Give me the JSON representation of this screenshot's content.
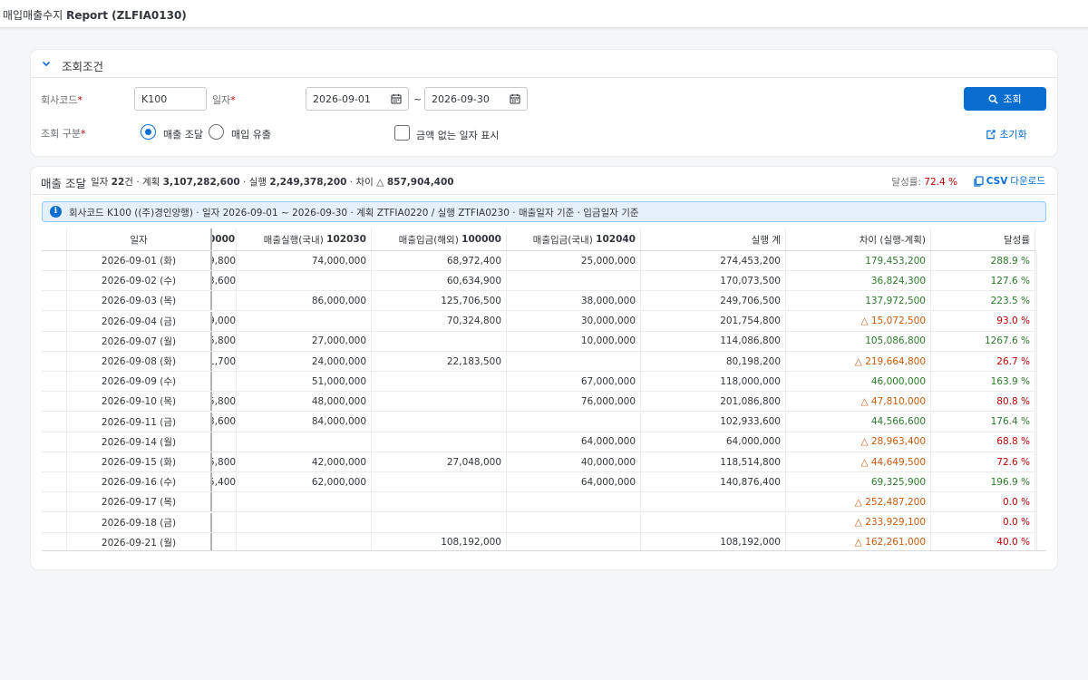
{
  "app": {
    "title_prefix": "매입매출수지",
    "title_bold": "Report (ZLFIA0130)"
  },
  "filter": {
    "header": "조회조건",
    "company_label": "회사코드",
    "company_value": "K100",
    "date_label": "일자",
    "date_from": "2026-09-01",
    "date_sep": "~",
    "date_to": "2026-09-30",
    "type_label": "조회 구분",
    "radio_sales": "매출 조달",
    "radio_purchase": "매입 유출",
    "radio_selected": "매출 조달",
    "checkbox_label": "금액 없는 일자 표시",
    "checkbox_checked": false,
    "search_button": "조회",
    "reset_button": "초기화",
    "required_mark": "*"
  },
  "result": {
    "title": "매출 조달",
    "summary": {
      "days_label": "일자",
      "days_value": "22",
      "days_unit": "건",
      "plan_label": "계획",
      "plan_value": "3,107,282,600",
      "actual_label": "실행",
      "actual_value": "2,249,378,200",
      "diff_label": "차이",
      "diff_value": "△ 857,904,400",
      "sep": "·"
    },
    "rate_label": "달성률:",
    "rate_value": "72.4 %",
    "csv_bold": "CSV",
    "csv_rest": "다운로드",
    "info_text": "회사코드 K100 ((주)경인양행) · 일자 2026-09-01 ~ 2026-09-30 · 계획 ZTFIA0220 / 실행 ZTFIA0230 · 매출일자 기준 · 입금일자 기준"
  },
  "table": {
    "headers": {
      "date": "일자",
      "partial": "0000",
      "sales_domestic": "매출실행(국내)",
      "sales_domestic_code": "102030",
      "deposit_foreign": "매출입금(해외)",
      "deposit_foreign_code": "100000",
      "deposit_domestic": "매출입금(국내)",
      "deposit_domestic_code": "102040",
      "actual_total": "실행 계",
      "diff": "차이 (실행-계획)",
      "rate": "달성률"
    },
    "rows": [
      {
        "date": "2026-09-01 (화)",
        "partial": "9,800",
        "sales_domestic": "74,000,000",
        "deposit_foreign": "68,972,400",
        "deposit_domestic": "25,000,000",
        "actual_total": "274,453,200",
        "diff": "179,453,200",
        "diff_neg": false,
        "rate": "288.9 %",
        "rate_low": false
      },
      {
        "date": "2026-09-02 (수)",
        "partial": "3,600",
        "sales_domestic": "",
        "deposit_foreign": "60,634,900",
        "deposit_domestic": "",
        "actual_total": "170,073,500",
        "diff": "36,824,300",
        "diff_neg": false,
        "rate": "127.6 %",
        "rate_low": false
      },
      {
        "date": "2026-09-03 (목)",
        "partial": "",
        "sales_domestic": "86,000,000",
        "deposit_foreign": "125,706,500",
        "deposit_domestic": "38,000,000",
        "actual_total": "249,706,500",
        "diff": "137,972,500",
        "diff_neg": false,
        "rate": "223.5 %",
        "rate_low": false
      },
      {
        "date": "2026-09-04 (금)",
        "partial": "9,000",
        "sales_domestic": "",
        "deposit_foreign": "70,324,800",
        "deposit_domestic": "30,000,000",
        "actual_total": "201,754,800",
        "diff": "△ 15,072,500",
        "diff_neg": true,
        "rate": "93.0 %",
        "rate_low": true
      },
      {
        "date": "2026-09-07 (월)",
        "partial": "5,800",
        "sales_domestic": "27,000,000",
        "deposit_foreign": "",
        "deposit_domestic": "10,000,000",
        "actual_total": "114,086,800",
        "diff": "105,086,800",
        "diff_neg": false,
        "rate": "1267.6 %",
        "rate_low": false
      },
      {
        "date": "2026-09-08 (화)",
        "partial": "1,700",
        "sales_domestic": "24,000,000",
        "deposit_foreign": "22,183,500",
        "deposit_domestic": "",
        "actual_total": "80,198,200",
        "diff": "△ 219,664,800",
        "diff_neg": true,
        "rate": "26.7 %",
        "rate_low": true
      },
      {
        "date": "2026-09-09 (수)",
        "partial": "",
        "sales_domestic": "51,000,000",
        "deposit_foreign": "",
        "deposit_domestic": "67,000,000",
        "actual_total": "118,000,000",
        "diff": "46,000,000",
        "diff_neg": false,
        "rate": "163.9 %",
        "rate_low": false
      },
      {
        "date": "2026-09-10 (목)",
        "partial": "5,800",
        "sales_domestic": "48,000,000",
        "deposit_foreign": "",
        "deposit_domestic": "76,000,000",
        "actual_total": "201,086,800",
        "diff": "△ 47,810,000",
        "diff_neg": true,
        "rate": "80.8 %",
        "rate_low": true
      },
      {
        "date": "2026-09-11 (금)",
        "partial": "3,600",
        "sales_domestic": "84,000,000",
        "deposit_foreign": "",
        "deposit_domestic": "",
        "actual_total": "102,933,600",
        "diff": "44,566,600",
        "diff_neg": false,
        "rate": "176.4 %",
        "rate_low": false
      },
      {
        "date": "2026-09-14 (월)",
        "partial": "",
        "sales_domestic": "",
        "deposit_foreign": "",
        "deposit_domestic": "64,000,000",
        "actual_total": "64,000,000",
        "diff": "△ 28,963,400",
        "diff_neg": true,
        "rate": "68.8 %",
        "rate_low": true
      },
      {
        "date": "2026-09-15 (화)",
        "partial": "5,800",
        "sales_domestic": "42,000,000",
        "deposit_foreign": "27,048,000",
        "deposit_domestic": "40,000,000",
        "actual_total": "118,514,800",
        "diff": "△ 44,649,500",
        "diff_neg": true,
        "rate": "72.6 %",
        "rate_low": true
      },
      {
        "date": "2026-09-16 (수)",
        "partial": "5,400",
        "sales_domestic": "62,000,000",
        "deposit_foreign": "",
        "deposit_domestic": "64,000,000",
        "actual_total": "140,876,400",
        "diff": "69,325,900",
        "diff_neg": false,
        "rate": "196.9 %",
        "rate_low": false
      },
      {
        "date": "2026-09-17 (목)",
        "partial": "",
        "sales_domestic": "",
        "deposit_foreign": "",
        "deposit_domestic": "",
        "actual_total": "",
        "diff": "△ 252,487,200",
        "diff_neg": true,
        "rate": "0.0 %",
        "rate_low": true
      },
      {
        "date": "2026-09-18 (금)",
        "partial": "",
        "sales_domestic": "",
        "deposit_foreign": "",
        "deposit_domestic": "",
        "actual_total": "",
        "diff": "△ 233,929,100",
        "diff_neg": true,
        "rate": "0.0 %",
        "rate_low": true
      },
      {
        "date": "2026-09-21 (월)",
        "partial": "",
        "sales_domestic": "",
        "deposit_foreign": "108,192,000",
        "deposit_domestic": "",
        "actual_total": "108,192,000",
        "diff": "△ 162,261,000",
        "diff_neg": true,
        "rate": "40.0 %",
        "rate_low": true
      }
    ]
  },
  "colors": {
    "accent": "#0a6ed1",
    "positive": "#2b7c2b",
    "negative_diff": "#c85a0e",
    "negative_rate": "#bb0000",
    "required": "#bb0000"
  }
}
